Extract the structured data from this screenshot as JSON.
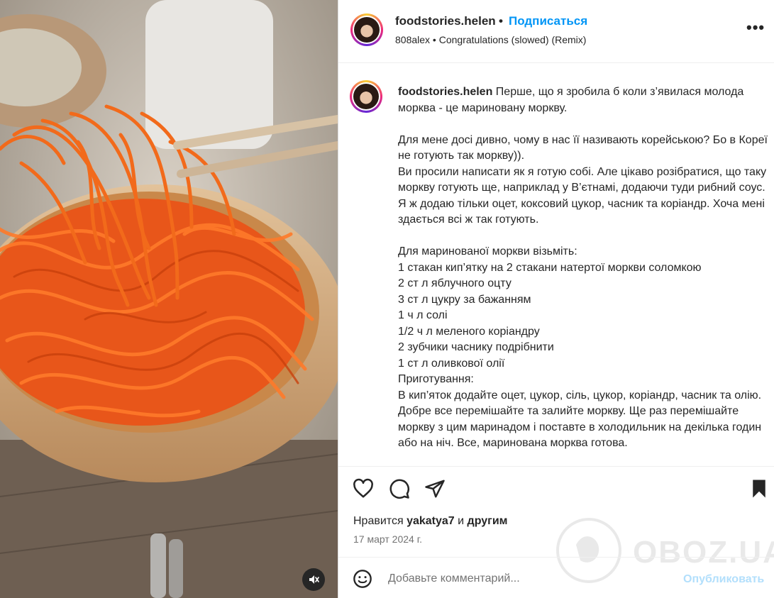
{
  "header": {
    "username": "foodstories.helen",
    "separator": "•",
    "follow_label": "Подписаться",
    "audio": "808alex • Congratulations (slowed) (Remix)",
    "more_label": "•••"
  },
  "caption": {
    "username": "foodstories.helen",
    "text": " Перше, що я зробила б коли з’явилася молода морква - це мариновану моркву.\n\nДля мене досі дивно, чому в нас її називають корейською? Бо в Кореї не готують так моркву)).\nВи просили написати як я готую собі. Але цікаво розібратися, що таку моркву готують ще, наприклад у В’єтнамі, додаючи туди рибний соус. Я ж додаю тільки оцет, коксовий цукор, часник та коріандр. Хоча мені здається всі ж так готують.\n\nДля маринованої моркви візьміть:\n1 стакан кип’ятку на 2 стакани натертої моркви соломкою\n2 ст л яблучного оцту\n3 ст л цукру за бажанням\n1 ч л солі\n1/2 ч л меленого коріандру\n2 зубчики часнику подрібнити\n1 ст л оливкової олії\nПриготування:\nВ кип’яток додайте оцет, цукор, сіль, цукор, коріандр, часник та олію. Добре все перемішайте та залийте моркву. Ще раз перемішайте моркву з цим маринадом і поставте в холодильник на декілька годин або на ніч. Все, маринована морква готова."
  },
  "likes": {
    "prefix": "Нравится",
    "user": "yakatya7",
    "middle": "и",
    "suffix": "другим"
  },
  "date": "17 март 2024 г.",
  "comment": {
    "placeholder": "Добавьте комментарий...",
    "post_label": "Опубликовать"
  },
  "watermark": "OBOZ.UA",
  "icons": [
    "heart-icon",
    "comment-icon",
    "share-icon",
    "bookmark-icon",
    "emoji-icon",
    "mute-icon",
    "more-icon"
  ],
  "colors": {
    "accent": "#0095f6",
    "post_disabled": "#b2dffc",
    "text": "#262626",
    "muted": "#737373",
    "carrot": "#f26a1b"
  }
}
